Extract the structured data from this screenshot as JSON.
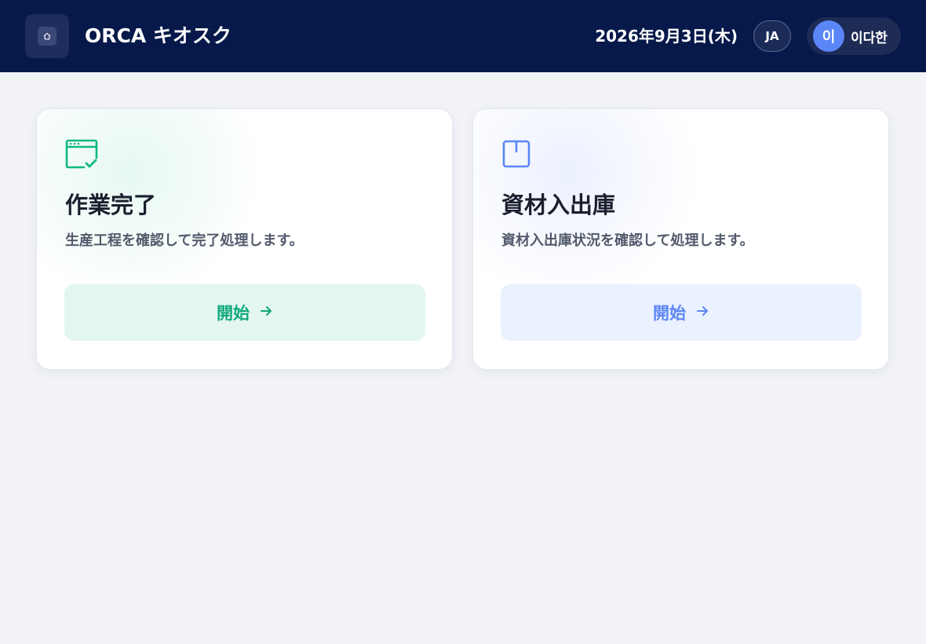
{
  "header": {
    "home_icon": "home-icon",
    "app_title": "ORCA キオスク",
    "date": "2026年9月3日(木)",
    "language": "JA",
    "user": {
      "avatar_initial": "이",
      "name": "이다한"
    }
  },
  "cards": [
    {
      "icon": "window-check-icon",
      "title": "作業完了",
      "description": "生産工程を確認して完了処理します。",
      "button_label": "開始",
      "button_icon": "arrow-right-icon",
      "accent_color": "#10b981"
    },
    {
      "icon": "box-icon",
      "title": "資材入出庫",
      "description": "資材入出庫状況を確認して処理します。",
      "button_label": "開始",
      "button_icon": "arrow-right-icon",
      "accent_color": "#5b86f7"
    }
  ],
  "colors": {
    "header_bg": "#06194a",
    "page_bg": "#f1f3f7",
    "avatar_bg": "#5b86f7"
  }
}
